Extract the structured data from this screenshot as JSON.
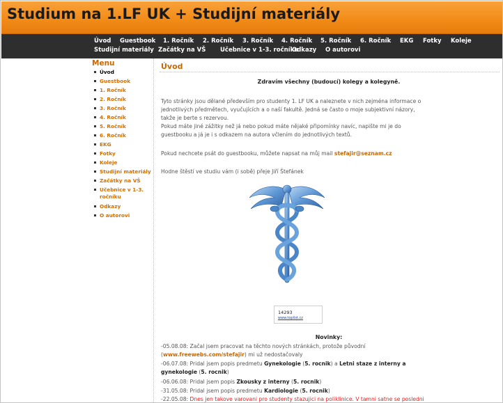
{
  "header": {
    "title": "Studium na 1.LF UK + Studijní materiály"
  },
  "nav": {
    "row1": [
      "Úvod",
      "Guestbook",
      "1. Ročník",
      "2. Ročník",
      "3. Ročník",
      "4. Ročník",
      "5. Ročník",
      "6. Ročník",
      "EKG",
      "Fotky",
      "Koleje"
    ],
    "row2": [
      "Studijní materiály",
      "Začátky na VŠ",
      "Učebnice v 1-3. ročníku",
      "Odkazy",
      "O autorovi"
    ]
  },
  "sidebar": {
    "title": "Menu",
    "items": [
      "Úvod",
      "Guestbook",
      "1. Ročník",
      "2. Ročník",
      "3. Ročník",
      "4. Ročník",
      "5. Ročník",
      "6. Ročník",
      "EKG",
      "Fotky",
      "Koleje",
      "Studijní materiály",
      "Začátky na VŠ",
      "Učebnice v 1-3. ročníku",
      "Odkazy",
      "O autorovi"
    ]
  },
  "content": {
    "title": "Úvod",
    "greeting": "Zdravím všechny (budoucí) kolegy a kolegyně.",
    "intro_lines": [
      "Tyto stránky jsou dělané především pro studenty 1. LF UK a naleznete v nich zejména informace o",
      "jednotlivých předmětech, vyučujících a o naší fakultě. Jedná se často o moje subjektivní názory,",
      "takže je berte s rezervou.",
      "Pokud máte jiné zážitky než já nebo pokud máte nějaké připomínky navíc, napište mi je do",
      "guestbooku a já je i s odkazem na autora včlením do jednotlivých textů."
    ],
    "mail_text": "Pokud nechcete psát do guestbooku, můžete napsat na můj mail ",
    "mail_address": "stefajir@seznam.cz",
    "wish": "Hodne štěstí ve studiu vám (i sobě) přeje Jiří Štefánek",
    "counter": {
      "value": "14293",
      "link": "www.toplist.cz"
    },
    "news_title": "Novinky:",
    "news": [
      {
        "a": "-05.08.08: Začal jsem pracovat na těchto nových stránkách, protože původní"
      },
      {
        "a": "(",
        "link": "www.freewebs.com/stefajir",
        "b": ") mi už nedostačovaly"
      },
      {
        "a": "-06.07.08: Pridal jsem popis predmetu ",
        "b1": "Gynekologie",
        "c": " (",
        "o1": "5. rocnik",
        "d": ") a ",
        "b2": "Letni staze z interny a"
      },
      {
        "b": "gynekologie",
        "a": " (",
        "o": "5. rocnik",
        "c": ")"
      },
      {
        "a": "-06.06.08: Pridal jsem popis ",
        "b": "Zkousky z interny",
        "c": " (",
        "o": "5. rocnik",
        "d": ")"
      },
      {
        "a": "-31.05.08: Pridal jsem popis predmetu ",
        "b": "Kardiologie",
        "c": " (",
        "o": "5. rocnik",
        "d": ")"
      },
      {
        "a": "-22.05.08: ",
        "red": "Dnes jen takove varovani pro studenty stazujici na poliklinice. V tamni satne se posledni"
      }
    ]
  }
}
